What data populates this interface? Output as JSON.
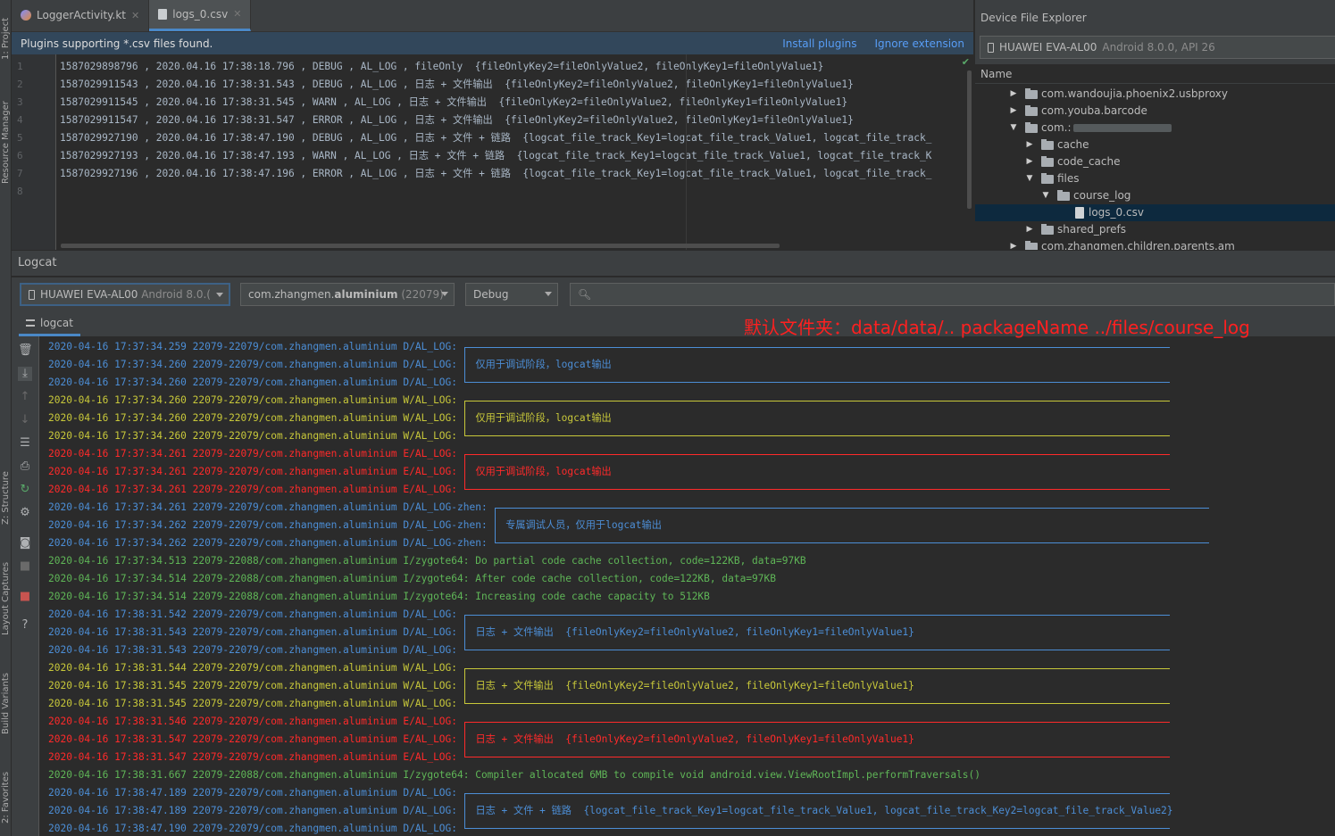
{
  "sidebar": {
    "project_tab": "1: Project",
    "resource_tab": "Resource Manager",
    "structure_tab": "Z: Structure",
    "layout_tab": "Layout Captures",
    "build_tab": "Build Variants",
    "favorites_tab": "2: Favorites"
  },
  "editor": {
    "tabs": [
      {
        "label": "LoggerActivity.kt",
        "icon": "kotlin-file-icon"
      },
      {
        "label": "logs_0.csv",
        "icon": "csv-file-icon",
        "active": true
      }
    ],
    "banner": {
      "message": "Plugins supporting *.csv files found.",
      "install": "Install plugins",
      "ignore": "Ignore extension"
    },
    "line_numbers": [
      "1",
      "2",
      "3",
      "4",
      "5",
      "6",
      "7",
      "8"
    ],
    "lines": [
      "1587029898796 , 2020.04.16 17:38:18.796 , DEBUG , AL_LOG , fileOnly  {fileOnlyKey2=fileOnlyValue2, fileOnlyKey1=fileOnlyValue1}",
      "1587029911543 , 2020.04.16 17:38:31.543 , DEBUG , AL_LOG , 日志 + 文件输出  {fileOnlyKey2=fileOnlyValue2, fileOnlyKey1=fileOnlyValue1}",
      "1587029911545 , 2020.04.16 17:38:31.545 , WARN , AL_LOG , 日志 + 文件输出  {fileOnlyKey2=fileOnlyValue2, fileOnlyKey1=fileOnlyValue1}",
      "1587029911547 , 2020.04.16 17:38:31.547 , ERROR , AL_LOG , 日志 + 文件输出  {fileOnlyKey2=fileOnlyValue2, fileOnlyKey1=fileOnlyValue1}",
      "1587029927190 , 2020.04.16 17:38:47.190 , DEBUG , AL_LOG , 日志 + 文件 + 链路  {logcat_file_track_Key1=logcat_file_track_Value1, logcat_file_track_",
      "1587029927193 , 2020.04.16 17:38:47.193 , WARN , AL_LOG , 日志 + 文件 + 链路  {logcat_file_track_Key1=logcat_file_track_Value1, logcat_file_track_K",
      "1587029927196 , 2020.04.16 17:38:47.196 , ERROR , AL_LOG , 日志 + 文件 + 链路  {logcat_file_track_Key1=logcat_file_track_Value1, logcat_file_track_",
      ""
    ]
  },
  "device_explorer": {
    "title": "Device File Explorer",
    "device": "HUAWEI EVA-AL00",
    "device_detail": "Android 8.0.0, API 26",
    "column": "Name",
    "tree": [
      {
        "label": "com.wandoujia.phoenix2.usbproxy",
        "type": "folder",
        "expanded": false
      },
      {
        "label": "com.youba.barcode",
        "type": "folder",
        "expanded": false
      },
      {
        "label": "com.:",
        "type": "folder",
        "expanded": true
      },
      {
        "label": "cache",
        "type": "folder",
        "expanded": false
      },
      {
        "label": "code_cache",
        "type": "folder",
        "expanded": false
      },
      {
        "label": "files",
        "type": "folder",
        "expanded": true
      },
      {
        "label": "course_log",
        "type": "folder",
        "expanded": true
      },
      {
        "label": "logs_0.csv",
        "type": "file",
        "selected": true
      },
      {
        "label": "shared_prefs",
        "type": "folder",
        "expanded": false
      },
      {
        "label": "com.zhangmen.children.parents.am",
        "type": "folder",
        "expanded": false
      }
    ]
  },
  "logcat": {
    "title": "Logcat",
    "device_combo": {
      "name": "HUAWEI EVA-AL00",
      "detail": "Android 8.0.("
    },
    "process_combo": {
      "prefix": "com.zhangmen.",
      "bold": "aluminium",
      "pid": "(22079)"
    },
    "level_combo": "Debug",
    "search_placeholder": "",
    "tab_label": "logcat",
    "annotation": "默认文件夹：data/data/.. packageName ../files/course_log",
    "colors": {
      "debug": "#4c8ed6",
      "warn": "#c8c83a",
      "error": "#ff2a2a",
      "info": "#5fb657"
    },
    "entries": [
      {
        "level": "d",
        "text": "2020-04-16 17:37:34.259 22079-22079/com.zhangmen.aluminium D/AL_LOG: ",
        "box": "top"
      },
      {
        "level": "d",
        "text": "2020-04-16 17:37:34.260 22079-22079/com.zhangmen.aluminium D/AL_LOG: ",
        "box": "mid",
        "msg": "仅用于调试阶段，logcat输出"
      },
      {
        "level": "d",
        "text": "2020-04-16 17:37:34.260 22079-22079/com.zhangmen.aluminium D/AL_LOG: ",
        "box": "bot"
      },
      {
        "level": "w",
        "text": "2020-04-16 17:37:34.260 22079-22079/com.zhangmen.aluminium W/AL_LOG: ",
        "box": "top"
      },
      {
        "level": "w",
        "text": "2020-04-16 17:37:34.260 22079-22079/com.zhangmen.aluminium W/AL_LOG: ",
        "box": "mid",
        "msg": "仅用于调试阶段，logcat输出"
      },
      {
        "level": "w",
        "text": "2020-04-16 17:37:34.260 22079-22079/com.zhangmen.aluminium W/AL_LOG: ",
        "box": "bot"
      },
      {
        "level": "e",
        "text": "2020-04-16 17:37:34.261 22079-22079/com.zhangmen.aluminium E/AL_LOG: ",
        "box": "top"
      },
      {
        "level": "e",
        "text": "2020-04-16 17:37:34.261 22079-22079/com.zhangmen.aluminium E/AL_LOG: ",
        "box": "mid",
        "msg": "仅用于调试阶段，logcat输出"
      },
      {
        "level": "e",
        "text": "2020-04-16 17:37:34.261 22079-22079/com.zhangmen.aluminium E/AL_LOG: ",
        "box": "bot"
      },
      {
        "level": "d",
        "text": "2020-04-16 17:37:34.261 22079-22079/com.zhangmen.aluminium D/AL_LOG-zhen: ",
        "box": "top"
      },
      {
        "level": "d",
        "text": "2020-04-16 17:37:34.262 22079-22079/com.zhangmen.aluminium D/AL_LOG-zhen: ",
        "box": "mid",
        "msg": "专属调试人员，仅用于logcat输出"
      },
      {
        "level": "d",
        "text": "2020-04-16 17:37:34.262 22079-22079/com.zhangmen.aluminium D/AL_LOG-zhen: ",
        "box": "bot"
      },
      {
        "level": "i",
        "text": "2020-04-16 17:37:34.513 22079-22088/com.zhangmen.aluminium I/zygote64: Do partial code cache collection, code=122KB, data=97KB"
      },
      {
        "level": "i",
        "text": "2020-04-16 17:37:34.514 22079-22088/com.zhangmen.aluminium I/zygote64: After code cache collection, code=122KB, data=97KB"
      },
      {
        "level": "i",
        "text": "2020-04-16 17:37:34.514 22079-22088/com.zhangmen.aluminium I/zygote64: Increasing code cache capacity to 512KB"
      },
      {
        "level": "d",
        "text": "2020-04-16 17:38:31.542 22079-22079/com.zhangmen.aluminium D/AL_LOG: ",
        "box": "top"
      },
      {
        "level": "d",
        "text": "2020-04-16 17:38:31.543 22079-22079/com.zhangmen.aluminium D/AL_LOG: ",
        "box": "mid",
        "msg": "日志 + 文件输出  {fileOnlyKey2=fileOnlyValue2, fileOnlyKey1=fileOnlyValue1}"
      },
      {
        "level": "d",
        "text": "2020-04-16 17:38:31.543 22079-22079/com.zhangmen.aluminium D/AL_LOG: ",
        "box": "bot"
      },
      {
        "level": "w",
        "text": "2020-04-16 17:38:31.544 22079-22079/com.zhangmen.aluminium W/AL_LOG: ",
        "box": "top"
      },
      {
        "level": "w",
        "text": "2020-04-16 17:38:31.545 22079-22079/com.zhangmen.aluminium W/AL_LOG: ",
        "box": "mid",
        "msg": "日志 + 文件输出  {fileOnlyKey2=fileOnlyValue2, fileOnlyKey1=fileOnlyValue1}"
      },
      {
        "level": "w",
        "text": "2020-04-16 17:38:31.545 22079-22079/com.zhangmen.aluminium W/AL_LOG: ",
        "box": "bot"
      },
      {
        "level": "e",
        "text": "2020-04-16 17:38:31.546 22079-22079/com.zhangmen.aluminium E/AL_LOG: ",
        "box": "top"
      },
      {
        "level": "e",
        "text": "2020-04-16 17:38:31.547 22079-22079/com.zhangmen.aluminium E/AL_LOG: ",
        "box": "mid",
        "msg": "日志 + 文件输出  {fileOnlyKey2=fileOnlyValue2, fileOnlyKey1=fileOnlyValue1}"
      },
      {
        "level": "e",
        "text": "2020-04-16 17:38:31.547 22079-22079/com.zhangmen.aluminium E/AL_LOG: ",
        "box": "bot"
      },
      {
        "level": "i",
        "text": "2020-04-16 17:38:31.667 22079-22088/com.zhangmen.aluminium I/zygote64: Compiler allocated 6MB to compile void android.view.ViewRootImpl.performTraversals()"
      },
      {
        "level": "d",
        "text": "2020-04-16 17:38:47.189 22079-22079/com.zhangmen.aluminium D/AL_LOG: ",
        "box": "top"
      },
      {
        "level": "d",
        "text": "2020-04-16 17:38:47.189 22079-22079/com.zhangmen.aluminium D/AL_LOG: ",
        "box": "mid",
        "msg": "日志 + 文件 + 链路  {logcat_file_track_Key1=logcat_file_track_Value1, logcat_file_track_Key2=logcat_file_track_Value2}"
      },
      {
        "level": "d",
        "text": "2020-04-16 17:38:47.190 22079-22079/com.zhangmen.aluminium D/AL_LOG: ",
        "box": "bot"
      }
    ]
  }
}
